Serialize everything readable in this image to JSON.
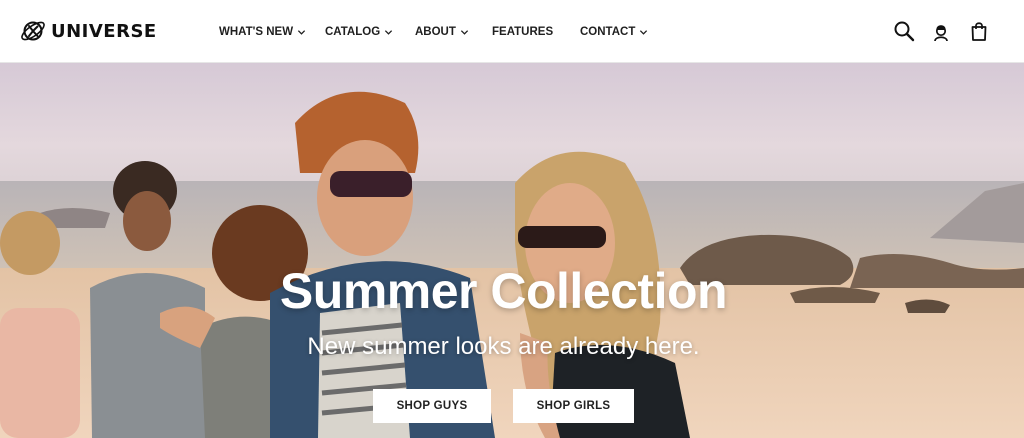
{
  "brand": {
    "name": "UNIVERSE",
    "logo_icon": "planet-logo-icon"
  },
  "nav": {
    "items": [
      {
        "label": "WHAT'S NEW",
        "has_dropdown": true
      },
      {
        "label": "CATALOG",
        "has_dropdown": true
      },
      {
        "label": "ABOUT",
        "has_dropdown": true
      },
      {
        "label": "FEATURES",
        "has_dropdown": false
      },
      {
        "label": "CONTACT",
        "has_dropdown": true
      }
    ]
  },
  "header_icons": [
    "search-icon",
    "account-icon",
    "shopping-bag-icon"
  ],
  "hero": {
    "title": "Summer Collection",
    "subtitle": "New summer looks are already here.",
    "buttons": [
      {
        "label": "SHOP GUYS"
      },
      {
        "label": "SHOP GIRLS"
      }
    ]
  },
  "colors": {
    "text_dark": "#1f1f1f",
    "hero_text": "#ffffff",
    "button_bg": "#ffffff"
  }
}
